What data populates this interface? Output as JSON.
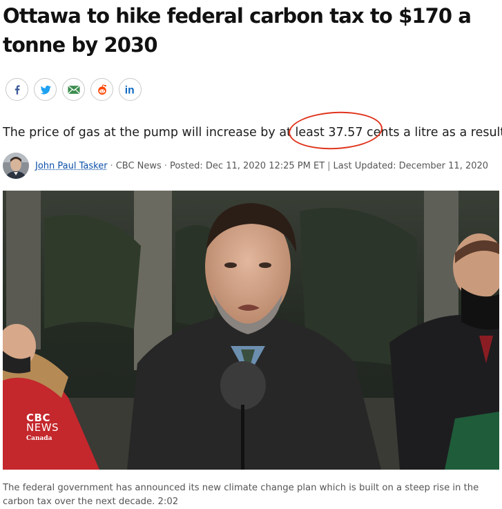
{
  "article": {
    "headline": "Ottawa to hike federal carbon tax to $170 a tonne by 2030",
    "deck_before": "The price of gas at the pump will increase by at least ",
    "deck_highlight": "37.57 cents",
    "deck_after": " a litre as a result",
    "author": "John Paul Tasker",
    "source": "CBC News",
    "posted": "Posted: Dec 11, 2020 12:25 PM ET",
    "updated": "Last Updated: December 11, 2020",
    "caption": "The federal government has announced its new climate change plan which is built on a steep rise in the carbon tax over the next decade.",
    "video_duration": "2:02"
  },
  "share": [
    {
      "name": "facebook",
      "icon": "facebook-icon",
      "color": "#3b5998"
    },
    {
      "name": "twitter",
      "icon": "twitter-icon",
      "color": "#1da1f2"
    },
    {
      "name": "email",
      "icon": "email-icon",
      "color": "#2e8b57"
    },
    {
      "name": "reddit",
      "icon": "reddit-icon",
      "color": "#ff4500"
    },
    {
      "name": "linkedin",
      "icon": "linkedin-icon",
      "color": "#0a66c2"
    }
  ],
  "media_overlay": {
    "logo_line1": "CBC",
    "logo_line2": "NEWS",
    "logo_line3": "Canada"
  },
  "colors": {
    "highlight_ring": "#e0331c",
    "author_link": "#0b4fa8"
  }
}
